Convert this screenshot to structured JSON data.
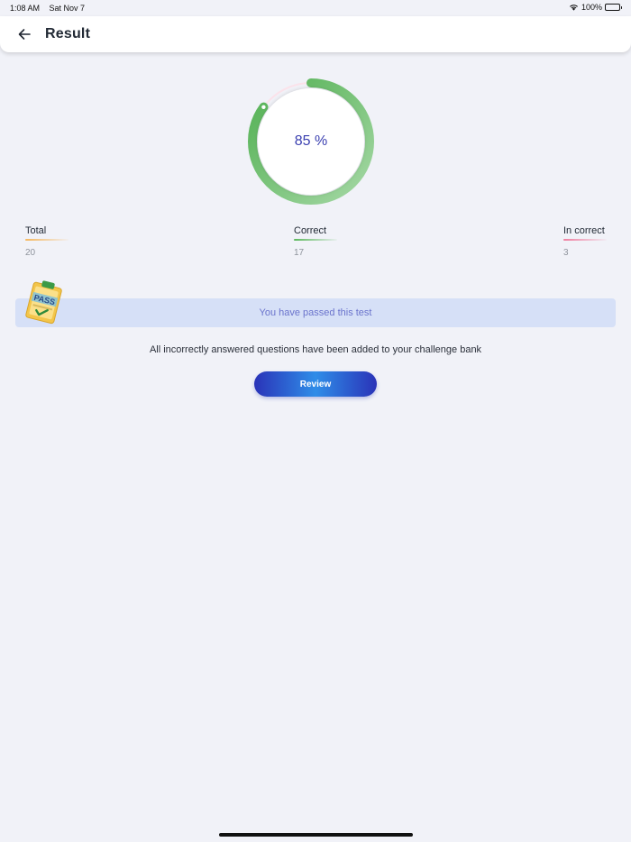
{
  "status_bar": {
    "time": "1:08 AM",
    "date": "Sat Nov 7",
    "battery": "100%"
  },
  "header": {
    "title": "Result"
  },
  "score": {
    "percent": 85,
    "label": "85 %"
  },
  "stats": [
    {
      "label": "Total",
      "value": "20",
      "color": "#f5b860"
    },
    {
      "label": "Correct",
      "value": "17",
      "color": "#5cb85c"
    },
    {
      "label": "In correct",
      "value": "3",
      "color": "#ef7fa0"
    }
  ],
  "result": {
    "message": "You have passed this test",
    "badge_text": "PASS"
  },
  "info": {
    "text": "All incorrectly answered questions have been added to your challenge bank"
  },
  "actions": {
    "review_label": "Review"
  },
  "colors": {
    "accent": "#2a33b8",
    "progress": "#5cb85c",
    "banner_bg": "#d6e0f7"
  }
}
